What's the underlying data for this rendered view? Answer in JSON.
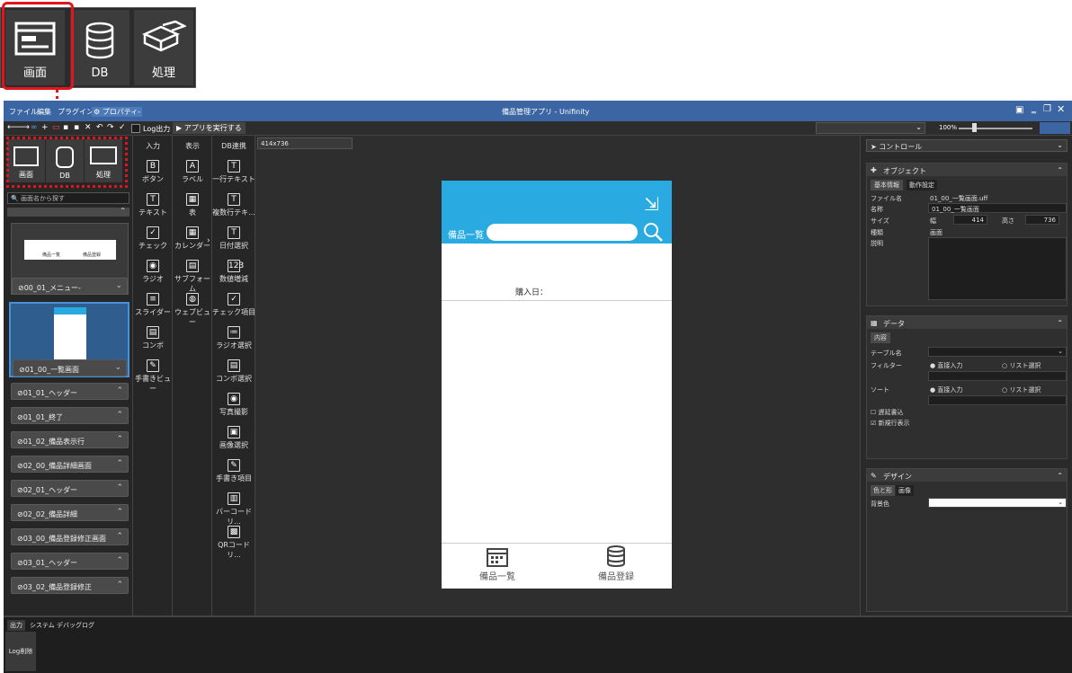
{
  "callout": {
    "tabs": [
      {
        "label": "画面",
        "icon": "screen-icon"
      },
      {
        "label": "DB",
        "icon": "database-icon"
      },
      {
        "label": "処理",
        "icon": "blocks-icon"
      }
    ]
  },
  "window": {
    "title": "備品管理アプリ - Unifinity",
    "menus": [
      "ファイル",
      "編集",
      "プラグイン",
      "⚙ プロパティ-"
    ],
    "toolbar": {
      "log_label": "Log出力",
      "run_label": "▶ アプリを実行する",
      "size_label": "414x736",
      "zoom": "100%"
    },
    "left": {
      "tabs": [
        "画面",
        "DB",
        "処理"
      ],
      "search_placeholder": "画面名から探す",
      "thumb1": "00_01_メニュー-",
      "thumb1_labels": [
        "備品一覧",
        "備品登録"
      ],
      "thumb2": "01_00_一覧画面",
      "items": [
        "01_01_ヘッダー",
        "01_01_終了",
        "01_02_備品表示行",
        "02_00_備品詳細画面",
        "02_01_ヘッダー",
        "02_02_備品詳細",
        "03_00_備品登録修正画面",
        "03_01_ヘッダー",
        "03_02_備品登録修正"
      ]
    },
    "palette": {
      "headers": [
        "入力",
        "表示",
        "DB連携"
      ],
      "input": [
        {
          "icon": "B",
          "label": "ボタン"
        },
        {
          "icon": "T",
          "label": "テキスト"
        },
        {
          "icon": "✓",
          "label": "チェック"
        },
        {
          "icon": "◉",
          "label": "ラジオ"
        },
        {
          "icon": "≡",
          "label": "スライダー"
        },
        {
          "icon": "▤",
          "label": "コンボ"
        },
        {
          "icon": "✎",
          "label": "手書きビュー"
        }
      ],
      "display": [
        {
          "icon": "A",
          "label": "ラベル"
        },
        {
          "icon": "▦",
          "label": "表"
        },
        {
          "icon": "▦",
          "label": "カレンダー"
        },
        {
          "icon": "▤",
          "label": "サブフォーム"
        },
        {
          "icon": "◍",
          "label": "ウェブビュー"
        }
      ],
      "db": [
        {
          "icon": "T",
          "label": "一行テキスト"
        },
        {
          "icon": "T",
          "label": "複数行テキ..."
        },
        {
          "icon": "T",
          "label": "日付選択"
        },
        {
          "icon": "123",
          "label": "数値増減"
        },
        {
          "icon": "✓",
          "label": "チェック項目"
        },
        {
          "icon": "≔",
          "label": "ラジオ選択"
        },
        {
          "icon": "▤",
          "label": "コンボ選択"
        },
        {
          "icon": "◉",
          "label": "写真撮影"
        },
        {
          "icon": "▣",
          "label": "画像選択"
        },
        {
          "icon": "✎",
          "label": "手書き項目"
        },
        {
          "icon": "▥",
          "label": "バーコードリ..."
        },
        {
          "icon": "▩",
          "label": "QRコードリ..."
        }
      ]
    },
    "phone": {
      "header_label": "備品一覧",
      "purchase_label": "購入日：",
      "tab1": "備品一覧",
      "tab2": "備品登録"
    },
    "right": {
      "control_label": "コントロール",
      "object_header": "オブジェクト",
      "object_tabs": [
        "基本情報",
        "動作設定"
      ],
      "file_name_label": "ファイル名",
      "file_name": "01_00_一覧画面.uff",
      "name_label": "名称",
      "name": "01_00_一覧画面",
      "size_label": "サイズ",
      "width_label": "幅",
      "width": "414",
      "height_label": "高さ",
      "height": "736",
      "type_label": "種類",
      "type": "画面",
      "desc_label": "説明",
      "data_header": "データ",
      "data_tab": "内容",
      "table_label": "テーブル名",
      "filter_label": "フィルター",
      "sort_label": "ソート",
      "direct_input": "直接入力",
      "list_select": "リスト選択",
      "delay_label": "遅延書込",
      "new_row_label": "新規行表示",
      "design_header": "デザイン",
      "design_tabs": [
        "色と形",
        "画像"
      ],
      "bg_label": "背景色"
    },
    "bottom": {
      "tabs": [
        "出力",
        "システム",
        "デバッグログ"
      ],
      "clear_label": "Log削除"
    }
  }
}
